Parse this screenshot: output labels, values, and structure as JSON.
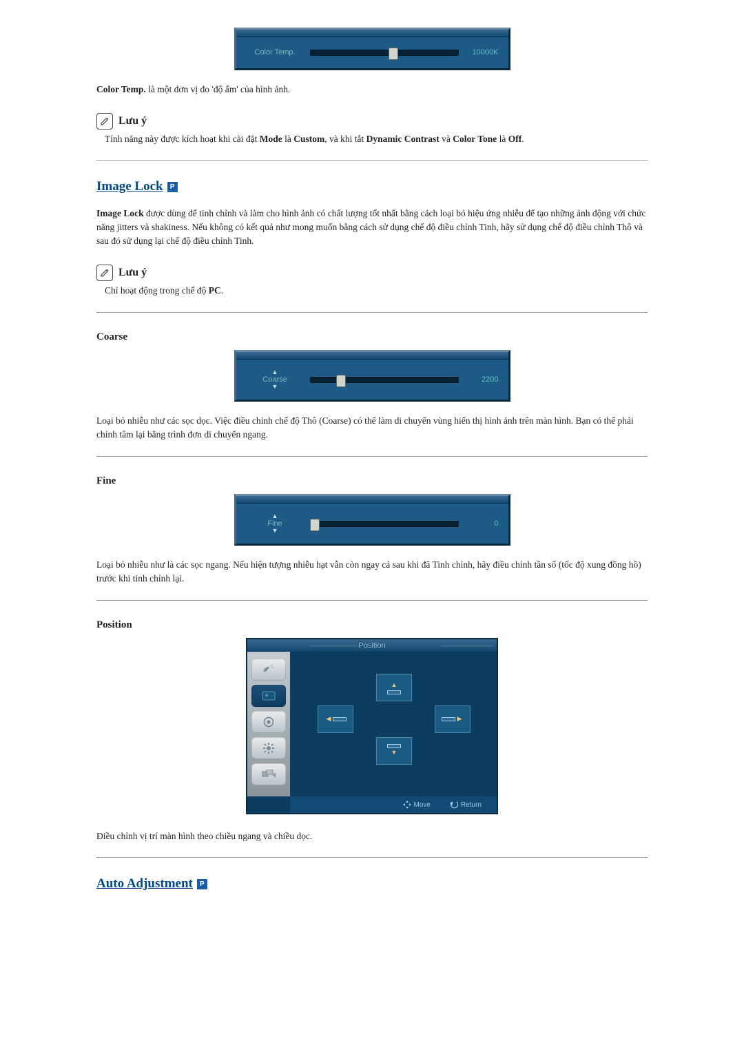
{
  "color_temp": {
    "label": "Color Temp.",
    "value": "10000K",
    "thumb_pos_pct": 53
  },
  "color_temp_desc": {
    "lead_bold": "Color Temp.",
    "rest": " là một đơn vị đo 'độ ấm' của hình ảnh."
  },
  "note1": {
    "title": "Lưu ý",
    "pre": "Tính năng này được kích hoạt khi cài đặt ",
    "b1": "Mode",
    "mid1": " là ",
    "b2": "Custom",
    "mid2": ", và khi tắt ",
    "b3": "Dynamic Contrast",
    "mid3": " và ",
    "b4": "Color Tone",
    "mid4": " là ",
    "b5": "Off",
    "tail": "."
  },
  "image_lock": {
    "title": "Image Lock",
    "badge": "P",
    "desc_bold": "Image Lock",
    "desc_rest": " được dùng để tinh chỉnh và làm cho hình ảnh có chất lượng tốt nhất bằng cách loại bỏ hiệu ứng nhiễu để tạo những ảnh động với chức năng jitters và shakiness. Nếu không có kết quả như mong muốn bằng cách sử dụng chế độ điều chỉnh Tinh, hãy sử dụng chế độ điều chỉnh Thô và sau đó sử dụng lại chế độ điều chỉnh Tinh."
  },
  "note2": {
    "title": "Lưu ý",
    "pre": "Chỉ hoạt động trong chế độ ",
    "b1": "PC",
    "tail": "."
  },
  "coarse": {
    "title": "Coarse",
    "label": "Coarse",
    "value": "2200",
    "thumb_pos_pct": 18,
    "desc": "Loại bỏ nhiễu như các sọc dọc. Việc điều chỉnh chế độ Thô (Coarse) có thể làm di chuyển vùng hiển thị hình ảnh trên màn hình. Bạn có thể phải chỉnh tâm lại bằng trình đơn di chuyển ngang."
  },
  "fine": {
    "title": "Fine",
    "label": "Fine",
    "value": "0",
    "thumb_pos_pct": 0,
    "desc": "Loại bỏ nhiễu như là các sọc ngang. Nếu hiện tượng nhiễu hạt vẫn còn ngay cả sau khi đã Tinh chỉnh, hãy điều chỉnh tần số (tốc độ xung đồng hồ) trước khi tinh chỉnh lại."
  },
  "position": {
    "title": "Position",
    "header": "Position",
    "move": "Move",
    "return": "Return",
    "desc": "Điều chỉnh vị trí màn hình theo chiều ngang và chiều dọc."
  },
  "auto_adjustment": {
    "title": "Auto Adjustment",
    "badge": "P"
  }
}
